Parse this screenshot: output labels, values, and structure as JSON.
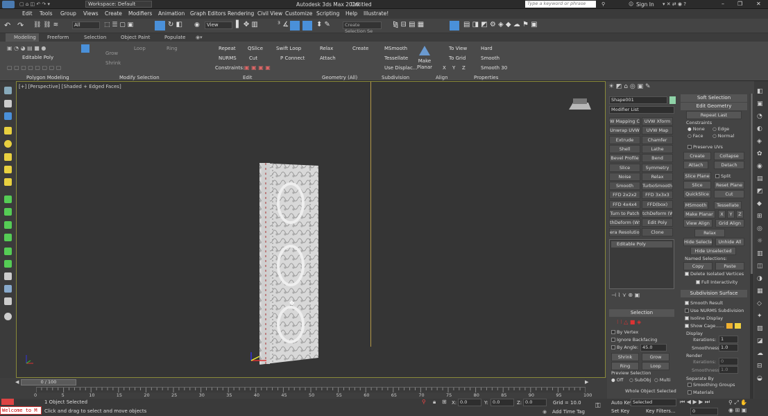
{
  "titlebar": {
    "workspace": "Workspace: Default",
    "title": "Autodesk 3ds Max 2016",
    "doc": "Untitled",
    "search_placeholder": "Type a keyword or phrase",
    "signin": "Sign In"
  },
  "menu": [
    "Edit",
    "Tools",
    "Group",
    "Views",
    "Create",
    "Modifiers",
    "Animation",
    "Graph Editors",
    "Rendering",
    "Civil View",
    "Customize",
    "Scripting",
    "Help",
    "Illustrate!"
  ],
  "toolbar": {
    "filter": "All",
    "view": "View",
    "selset": "Create Selection Se"
  },
  "ribbon_tabs": [
    "Modeling",
    "Freeform",
    "Selection",
    "Object Paint",
    "Populate"
  ],
  "ribbon": {
    "editable_poly": "Editable Poly",
    "grow": "Grow",
    "shrink": "Shrink",
    "loop": "Loop",
    "ring": "Ring",
    "repeat": "Repeat",
    "qslice": "QSlice",
    "swift_loop": "Swift Loop",
    "nurms": "NURMS",
    "cut": "Cut",
    "p_connect": "P Connect",
    "constraints": "Constraints:",
    "relax": "Relax",
    "create": "Create",
    "attach": "Attach",
    "msmooth": "MSmooth",
    "tessellate": "Tessellate",
    "use_displac": "Use Displac...",
    "make_planar": "Make Planar",
    "to_view": "To View",
    "to_grid": "To Grid",
    "x": "X",
    "y": "Y",
    "z": "Z",
    "hard": "Hard",
    "smooth": "Smooth",
    "smooth30": "Smooth 30",
    "cap_polygon": "Polygon Modeling",
    "cap_modsel": "Modify Selection",
    "cap_edit": "Edit",
    "cap_geometry": "Geometry (All)",
    "cap_subdivision": "Subdivision",
    "cap_align": "Align",
    "cap_properties": "Properties"
  },
  "viewport": {
    "label": "[+] [Perspective] [Shaded + Edged Faces]"
  },
  "cmd": {
    "object_name": "Shape001",
    "modifier_list": "Modifier List",
    "modifiers": [
      "W Mapping Cle",
      "UVW Xform",
      "Unwrap UVW",
      "UVW Map",
      "Extrude",
      "Chamfer",
      "Shell",
      "Lathe",
      "Bevel Profile",
      "Bend",
      "Slice",
      "Symmetry",
      "Noise",
      "Relax",
      "Smooth",
      "TurboSmooth",
      "FFD 2x2x2",
      "FFD 3x3x3",
      "FFD 4x4x4",
      "FFD(box)",
      "Turn to Patch",
      "tchDeform (WS",
      "thDeform (WSI",
      "Edit Poly",
      "era Resolution",
      "Clone"
    ],
    "stack_item": "Editable Poly",
    "selection_hdr": "Selection",
    "by_vertex": "By Vertex",
    "ignore_backfacing": "Ignore Backfacing",
    "by_angle": "By Angle:",
    "by_angle_val": "45.0",
    "shrink": "Shrink",
    "grow": "Grow",
    "ring": "Ring",
    "loop": "Loop",
    "preview_selection": "Preview Selection",
    "off": "Off",
    "subobj": "SubObj",
    "multi": "Multi",
    "whole_object": "Whole Object Selected"
  },
  "roll": {
    "soft_selection": "Soft Selection",
    "edit_geometry": "Edit Geometry",
    "repeat_last": "Repeat Last",
    "constraints": "Constraints",
    "none": "None",
    "edge": "Edge",
    "face": "Face",
    "normal": "Normal",
    "preserve_uvs": "Preserve UVs",
    "create": "Create",
    "collapse": "Collapse",
    "attach": "Attach",
    "detach": "Detach",
    "slice_plane": "Slice Plane",
    "split": "Split",
    "slice": "Slice",
    "reset_plane": "Reset Plane",
    "quickslice": "QuickSlice",
    "cut": "Cut",
    "msmooth": "MSmooth",
    "tessellate": "Tessellate",
    "make_planar": "Make Planar",
    "x": "X",
    "y": "Y",
    "z": "Z",
    "view_align": "View Align",
    "grid_align": "Grid Align",
    "relax": "Relax",
    "hide_selected": "Hide Selected",
    "unhide_all": "Unhide All",
    "hide_unselected": "Hide Unselected",
    "named_selections": "Named Selections:",
    "copy": "Copy",
    "paste": "Paste",
    "delete_isolated": "Delete Isolated Vertices",
    "full_interactivity": "Full Interactivity",
    "subdivision_surface": "Subdivision Surface",
    "smooth_result": "Smooth Result",
    "use_nurms": "Use NURMS Subdivision",
    "isoline_display": "Isoline Display",
    "show_cage": "Show Cage......",
    "display": "Display",
    "iterations": "Iterations:",
    "iterations_val": "1",
    "smoothness": "Smoothness:",
    "smoothness_val": "1.0",
    "render": "Render",
    "r_iterations": "Iterations:",
    "r_iterations_val": "0",
    "r_smoothness": "Smoothness:",
    "r_smoothness_val": "1.0",
    "separate_by": "Separate By",
    "smoothing_groups": "Smoothing Groups",
    "materials": "Materials"
  },
  "timeline": {
    "frame": "0 / 100",
    "ticks": [
      "0",
      "5",
      "10",
      "15",
      "20",
      "25",
      "30",
      "35",
      "40",
      "45",
      "50",
      "55",
      "60",
      "65",
      "70",
      "75",
      "80",
      "85",
      "90",
      "95",
      "100"
    ]
  },
  "status": {
    "welcome": "Welcome to M",
    "selected": "1 Object Selected",
    "prompt": "Click and drag to select and move objects",
    "x": "X:",
    "x_val": "0.0",
    "y": "Y:",
    "y_val": "0.0",
    "z": "Z:",
    "z_val": "0.0",
    "grid": "Grid = 10.0",
    "add_time_tag": "Add Time Tag",
    "auto_key": "Auto Key",
    "selected_dd": "Selected",
    "set_key": "Set Key",
    "key_filters": "Key Filters...",
    "frame_val": "0"
  },
  "colors": {
    "accent": "#4a90d9",
    "swatch": "#8fd3a8",
    "cage1": "#f0b030",
    "cage2": "#f0d040"
  }
}
